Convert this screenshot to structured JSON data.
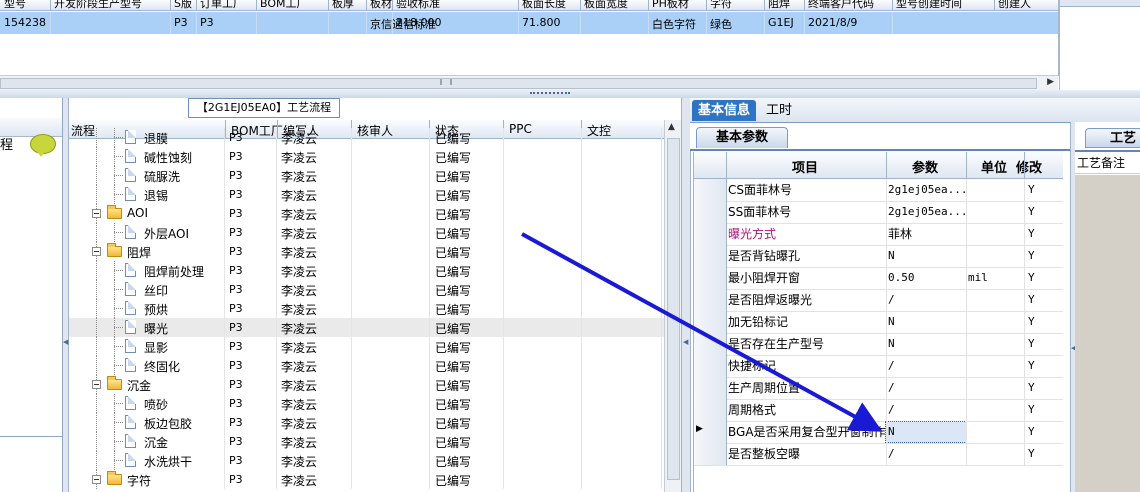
{
  "top_grid": {
    "headers": [
      "型号",
      "开发阶段生产型号",
      "S版",
      "订单工厂",
      "BOM工厂",
      "板厚",
      "板材",
      "验收标准",
      "板面长度",
      "板面宽度",
      "PH板材",
      "字符",
      "阻焊",
      "终端客户代码",
      "型号创建时间",
      "创建人"
    ],
    "row": [
      "154238",
      "",
      "P3",
      "P3",
      "",
      "",
      "京信通信标准",
      "218.000",
      "71.800",
      "",
      "白色字符",
      "绿色",
      "G1EJ",
      "2021/8/9",
      ""
    ]
  },
  "left_panel": {
    "label": "程"
  },
  "process_title": "【2G1EJ05EA0】工艺流程",
  "tree": {
    "columns": [
      "流程",
      "BOM工厂",
      "编写人",
      "核审人",
      "状态",
      "PPC",
      "文控"
    ],
    "rows": [
      {
        "name": "退膜",
        "level": 2,
        "type": "doc",
        "bom": "P3",
        "writer": "李凌云",
        "status": "已编写",
        "partial": true
      },
      {
        "name": "碱性蚀刻",
        "level": 2,
        "type": "doc",
        "bom": "P3",
        "writer": "李凌云",
        "status": "已编写"
      },
      {
        "name": "硫脲洗",
        "level": 2,
        "type": "doc",
        "bom": "P3",
        "writer": "李凌云",
        "status": "已编写"
      },
      {
        "name": "退锡",
        "level": 2,
        "type": "doc",
        "bom": "P3",
        "writer": "李凌云",
        "status": "已编写"
      },
      {
        "name": "AOI",
        "level": 1,
        "type": "folder",
        "bom": "P3",
        "writer": "李凌云",
        "status": "已编写"
      },
      {
        "name": "外层AOI",
        "level": 2,
        "type": "doc",
        "bom": "P3",
        "writer": "李凌云",
        "status": "已编写"
      },
      {
        "name": "阻焊",
        "level": 1,
        "type": "folder",
        "bom": "P3",
        "writer": "李凌云",
        "status": "已编写"
      },
      {
        "name": "阻焊前处理",
        "level": 2,
        "type": "doc",
        "bom": "P3",
        "writer": "李凌云",
        "status": "已编写"
      },
      {
        "name": "丝印",
        "level": 2,
        "type": "doc",
        "bom": "P3",
        "writer": "李凌云",
        "status": "已编写"
      },
      {
        "name": "预烘",
        "level": 2,
        "type": "doc",
        "bom": "P3",
        "writer": "李凌云",
        "status": "已编写"
      },
      {
        "name": "曝光",
        "level": 2,
        "type": "doc",
        "bom": "P3",
        "writer": "李凌云",
        "status": "已编写",
        "selected": true
      },
      {
        "name": "显影",
        "level": 2,
        "type": "doc",
        "bom": "P3",
        "writer": "李凌云",
        "status": "已编写"
      },
      {
        "name": "终固化",
        "level": 2,
        "type": "doc",
        "bom": "P3",
        "writer": "李凌云",
        "status": "已编写"
      },
      {
        "name": "沉金",
        "level": 1,
        "type": "folder",
        "bom": "P3",
        "writer": "李凌云",
        "status": "已编写"
      },
      {
        "name": "喷砂",
        "level": 2,
        "type": "doc",
        "bom": "P3",
        "writer": "李凌云",
        "status": "已编写"
      },
      {
        "name": "板边包胶",
        "level": 2,
        "type": "doc",
        "bom": "P3",
        "writer": "李凌云",
        "status": "已编写"
      },
      {
        "name": "沉金",
        "level": 2,
        "type": "doc",
        "bom": "P3",
        "writer": "李凌云",
        "status": "已编写"
      },
      {
        "name": "水洗烘干",
        "level": 2,
        "type": "doc",
        "bom": "P3",
        "writer": "李凌云",
        "status": "已编写"
      },
      {
        "name": "字符",
        "level": 1,
        "type": "folder",
        "bom": "P3",
        "writer": "李凌云",
        "status": "已编写"
      }
    ]
  },
  "tabs": [
    "基本信息",
    "工时"
  ],
  "subtab": "基本参数",
  "params": {
    "columns": [
      "项目",
      "参数",
      "单位",
      "修改"
    ],
    "rows": [
      {
        "item": "CS面菲林号",
        "value": "2g1ej05ea...",
        "unit": "",
        "mod": "Y"
      },
      {
        "item": "SS面菲林号",
        "value": "2g1ej05ea...",
        "unit": "",
        "mod": "Y"
      },
      {
        "item": "曝光方式",
        "value": "菲林",
        "unit": "",
        "mod": "Y",
        "highlight": true
      },
      {
        "item": "是否背钻曝孔",
        "value": "N",
        "unit": "",
        "mod": "Y"
      },
      {
        "item": "最小阻焊开窗",
        "value": "0.50",
        "unit": "mil",
        "mod": "Y"
      },
      {
        "item": "是否阻焊返曝光",
        "value": "/",
        "unit": "",
        "mod": "Y"
      },
      {
        "item": "加无铅标记",
        "value": "N",
        "unit": "",
        "mod": "Y"
      },
      {
        "item": "是否存在生产型号",
        "value": "N",
        "unit": "",
        "mod": "Y"
      },
      {
        "item": "快捷标记",
        "value": "/",
        "unit": "",
        "mod": "Y"
      },
      {
        "item": "生产周期位置",
        "value": "/",
        "unit": "",
        "mod": "Y"
      },
      {
        "item": "周期格式",
        "value": "/",
        "unit": "",
        "mod": "Y"
      },
      {
        "item": "BGA是否采用复合型开窗制作",
        "value": "N",
        "unit": "",
        "mod": "Y",
        "current": true
      },
      {
        "item": "是否整板空曝",
        "value": "/",
        "unit": "",
        "mod": "Y"
      }
    ]
  },
  "craft_panel": {
    "tab": "工艺",
    "note": "工艺备注"
  },
  "colors": {
    "selection": "#aad0f7",
    "accent_tab": "#2d74c4",
    "arrow": "#1a1ad6",
    "highlight_text": "#b0127a"
  }
}
